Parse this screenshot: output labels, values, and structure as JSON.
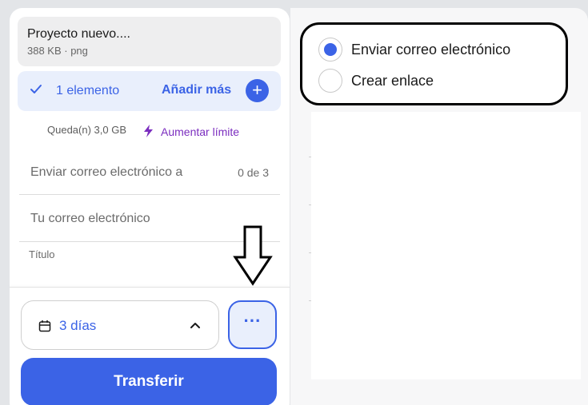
{
  "file": {
    "name": "Proyecto nuevo....",
    "meta": "388 KB · png"
  },
  "items": {
    "count_label": "1 elemento",
    "add_more_label": "Añadir más"
  },
  "quota": {
    "remaining": "Queda(n) 3,0 GB",
    "raise_limit_label": "Aumentar límite"
  },
  "form": {
    "send_to_placeholder": "Enviar correo electrónico a",
    "send_to_count": "0 de 3",
    "your_email_placeholder": "Tu correo electrónico",
    "title_label": "Título"
  },
  "expiry": {
    "value": "3 días"
  },
  "more_label": "···",
  "transfer_label": "Transferir",
  "share_options": [
    {
      "label": "Enviar correo electrónico",
      "selected": true
    },
    {
      "label": "Crear enlace",
      "selected": false
    }
  ],
  "colors": {
    "accent": "#3b63e6",
    "upgrade": "#7b2dbf",
    "highlight_bg": "#e9effc"
  }
}
